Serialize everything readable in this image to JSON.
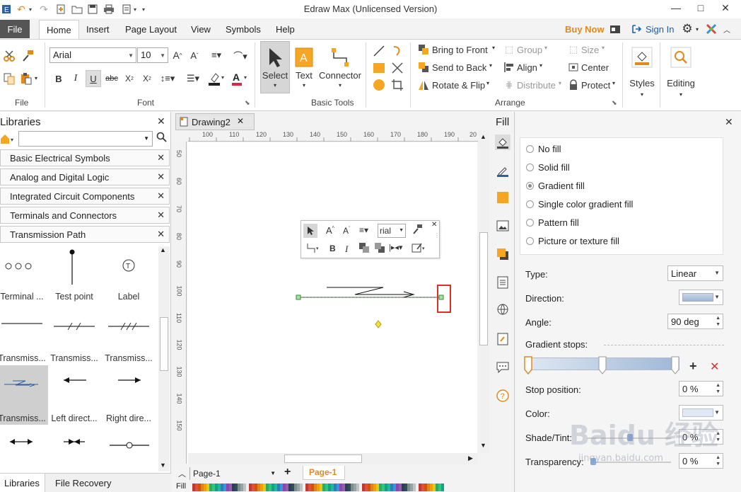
{
  "window": {
    "title": "Edraw Max (Unlicensed Version)",
    "min_symbol": "—",
    "max_symbol": "□",
    "close_symbol": "✕"
  },
  "menu": {
    "file": "File",
    "tabs": [
      "Home",
      "Insert",
      "Page Layout",
      "View",
      "Symbols",
      "Help"
    ],
    "buy_now": "Buy Now",
    "sign_in": "Sign In"
  },
  "ribbon": {
    "groups": {
      "file": "File",
      "font": "Font",
      "basic_tools": "Basic Tools",
      "arrange": "Arrange"
    },
    "font_name": "Arial",
    "font_size": "10",
    "tools": [
      "Select",
      "Text",
      "Connector"
    ],
    "arrange": {
      "bring_to_front": "Bring to Front",
      "send_to_back": "Send to Back",
      "rotate_flip": "Rotate & Flip",
      "group": "Group",
      "align": "Align",
      "distribute": "Distribute",
      "size": "Size",
      "center": "Center",
      "protect": "Protect"
    },
    "styles": "Styles",
    "editing": "Editing"
  },
  "libraries": {
    "title": "Libraries",
    "categories": [
      "Basic Electrical Symbols",
      "Analog and Digital Logic",
      "Integrated Circuit Components",
      "Terminals and Connectors",
      "Transmission Path"
    ],
    "shapes": [
      "Terminal ...",
      "Test point",
      "Label",
      "Transmiss...",
      "Transmiss...",
      "Transmiss...",
      "Transmiss...",
      "Left direct...",
      "Right dire..."
    ],
    "bottom_tabs": [
      "Libraries",
      "File Recovery"
    ]
  },
  "document": {
    "tab": "Drawing2",
    "ruler_h": [
      "100",
      "110",
      "120",
      "130",
      "140",
      "150",
      "160",
      "170",
      "180",
      "190",
      "20"
    ],
    "ruler_v": [
      "50",
      "60",
      "70",
      "80",
      "90",
      "100",
      "110",
      "120",
      "130",
      "140",
      "150"
    ],
    "page_select": "Page-1",
    "page_tab": "Page-1",
    "fill_label": "Fill"
  },
  "minibar": {
    "font_value": "rial"
  },
  "fill_panel": {
    "title": "Fill",
    "options": [
      "No fill",
      "Solid fill",
      "Gradient fill",
      "Single color gradient fill",
      "Pattern fill",
      "Picture or texture fill"
    ],
    "selected": "Gradient fill",
    "type_label": "Type:",
    "type_value": "Linear",
    "direction_label": "Direction:",
    "angle_label": "Angle:",
    "angle_value": "90 deg",
    "gradient_stops_label": "Gradient stops:",
    "stop_position_label": "Stop position:",
    "stop_position_value": "0 %",
    "color_label": "Color:",
    "shade_label": "Shade/Tint:",
    "shade_value": "0 %",
    "transparency_label": "Transparency:",
    "transparency_value": "0 %"
  },
  "colors": {
    "accent_orange": "#e08a1e",
    "link_blue": "#1c5fa8",
    "selection_red": "#d9302c",
    "gradient_start": "#dfe8f3",
    "gradient_end": "#9fb7d6"
  },
  "watermark": {
    "big": "Baidu 经验",
    "small": "jingyan.baidu.com"
  }
}
